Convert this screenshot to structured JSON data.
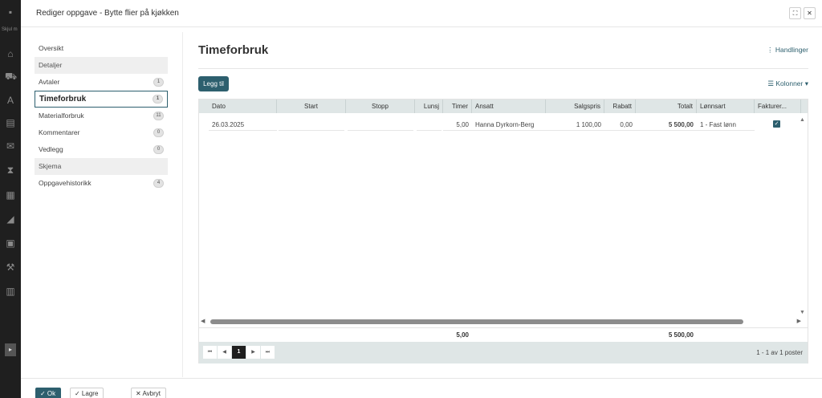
{
  "background_app": {
    "sidebar_hint": "Skjul m"
  },
  "dialog": {
    "title": "Rediger oppgave - Bytte flier på kjøkken",
    "maximize_glyph": "⛶",
    "close_glyph": "✕"
  },
  "nav": {
    "items": [
      {
        "label": "Oversikt",
        "badge": null,
        "section": false,
        "active": false
      },
      {
        "label": "Detaljer",
        "badge": null,
        "section": true,
        "active": false
      },
      {
        "label": "Avtaler",
        "badge": "1",
        "section": false,
        "active": false
      },
      {
        "label": "Timeforbruk",
        "badge": "1",
        "section": false,
        "active": true
      },
      {
        "label": "Materialforbruk",
        "badge": "11",
        "section": false,
        "active": false
      },
      {
        "label": "Kommentarer",
        "badge": "0",
        "section": false,
        "active": false
      },
      {
        "label": "Vedlegg",
        "badge": "0",
        "section": false,
        "active": false
      },
      {
        "label": "Skjema",
        "badge": null,
        "section": true,
        "active": false
      },
      {
        "label": "Oppgavehistorikk",
        "badge": "4",
        "section": false,
        "active": false
      }
    ]
  },
  "main": {
    "title": "Timeforbruk",
    "actions_label": "⋮ Handlinger",
    "add_label": "Legg til",
    "columns_label": "☰ Kolonner ▾"
  },
  "grid": {
    "headers": [
      "Dato",
      "Start",
      "Stopp",
      "Lunsj",
      "Timer",
      "Ansatt",
      "Salgspris",
      "Rabatt",
      "Totalt",
      "Lønnsart",
      "Fakturer..."
    ],
    "rows": [
      {
        "dato": "26.03.2025",
        "start": "",
        "stopp": "",
        "lunsj": "",
        "timer": "5,00",
        "ansatt": "Hanna Dyrkorn-Berg",
        "salgspris": "1 100,00",
        "rabatt": "0,00",
        "totalt": "5 500,00",
        "lonnsart": "1 - Fast lønn",
        "fakturer": true
      }
    ],
    "footer": {
      "timer_sum": "5,00",
      "totalt_sum": "5 500,00"
    },
    "pager": {
      "first": "⏮",
      "prev": "◀",
      "current_page": "1",
      "next": "▶",
      "last": "⏭",
      "info": "1 - 1 av 1 poster"
    }
  },
  "footer": {
    "ok_label": "✓ Ok",
    "save_label": "✓ Lagre",
    "cancel_label": "✕ Avbryt"
  },
  "colors": {
    "accent": "#2d5f6e",
    "grid_header": "#dfe6e6"
  }
}
